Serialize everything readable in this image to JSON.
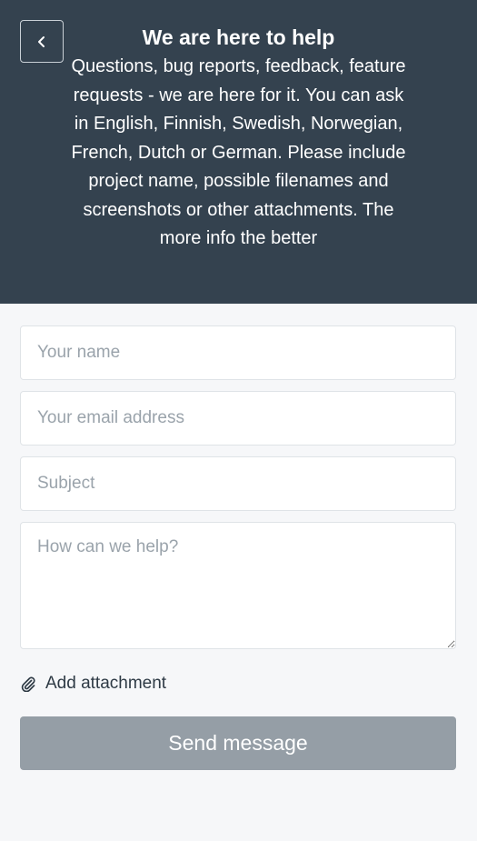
{
  "header": {
    "back_icon": "chevron-left-icon",
    "title": "We are here to help",
    "subtitle": "Questions, bug reports, feedback, feature requests - we are here for it. You can ask in English, Finnish, Swedish, Norwegian, French, Dutch or German. Please include project name, possible filenames and screenshots or other attachments. The more info the better",
    "background_color": "#34424f"
  },
  "form": {
    "name_placeholder": "Your name",
    "email_placeholder": "Your email address",
    "subject_placeholder": "Subject",
    "message_placeholder": "How can we help?",
    "attachment_icon": "paperclip-icon",
    "attachment_label": "Add attachment",
    "send_label": "Send message",
    "send_button_color": "#959ea6"
  }
}
